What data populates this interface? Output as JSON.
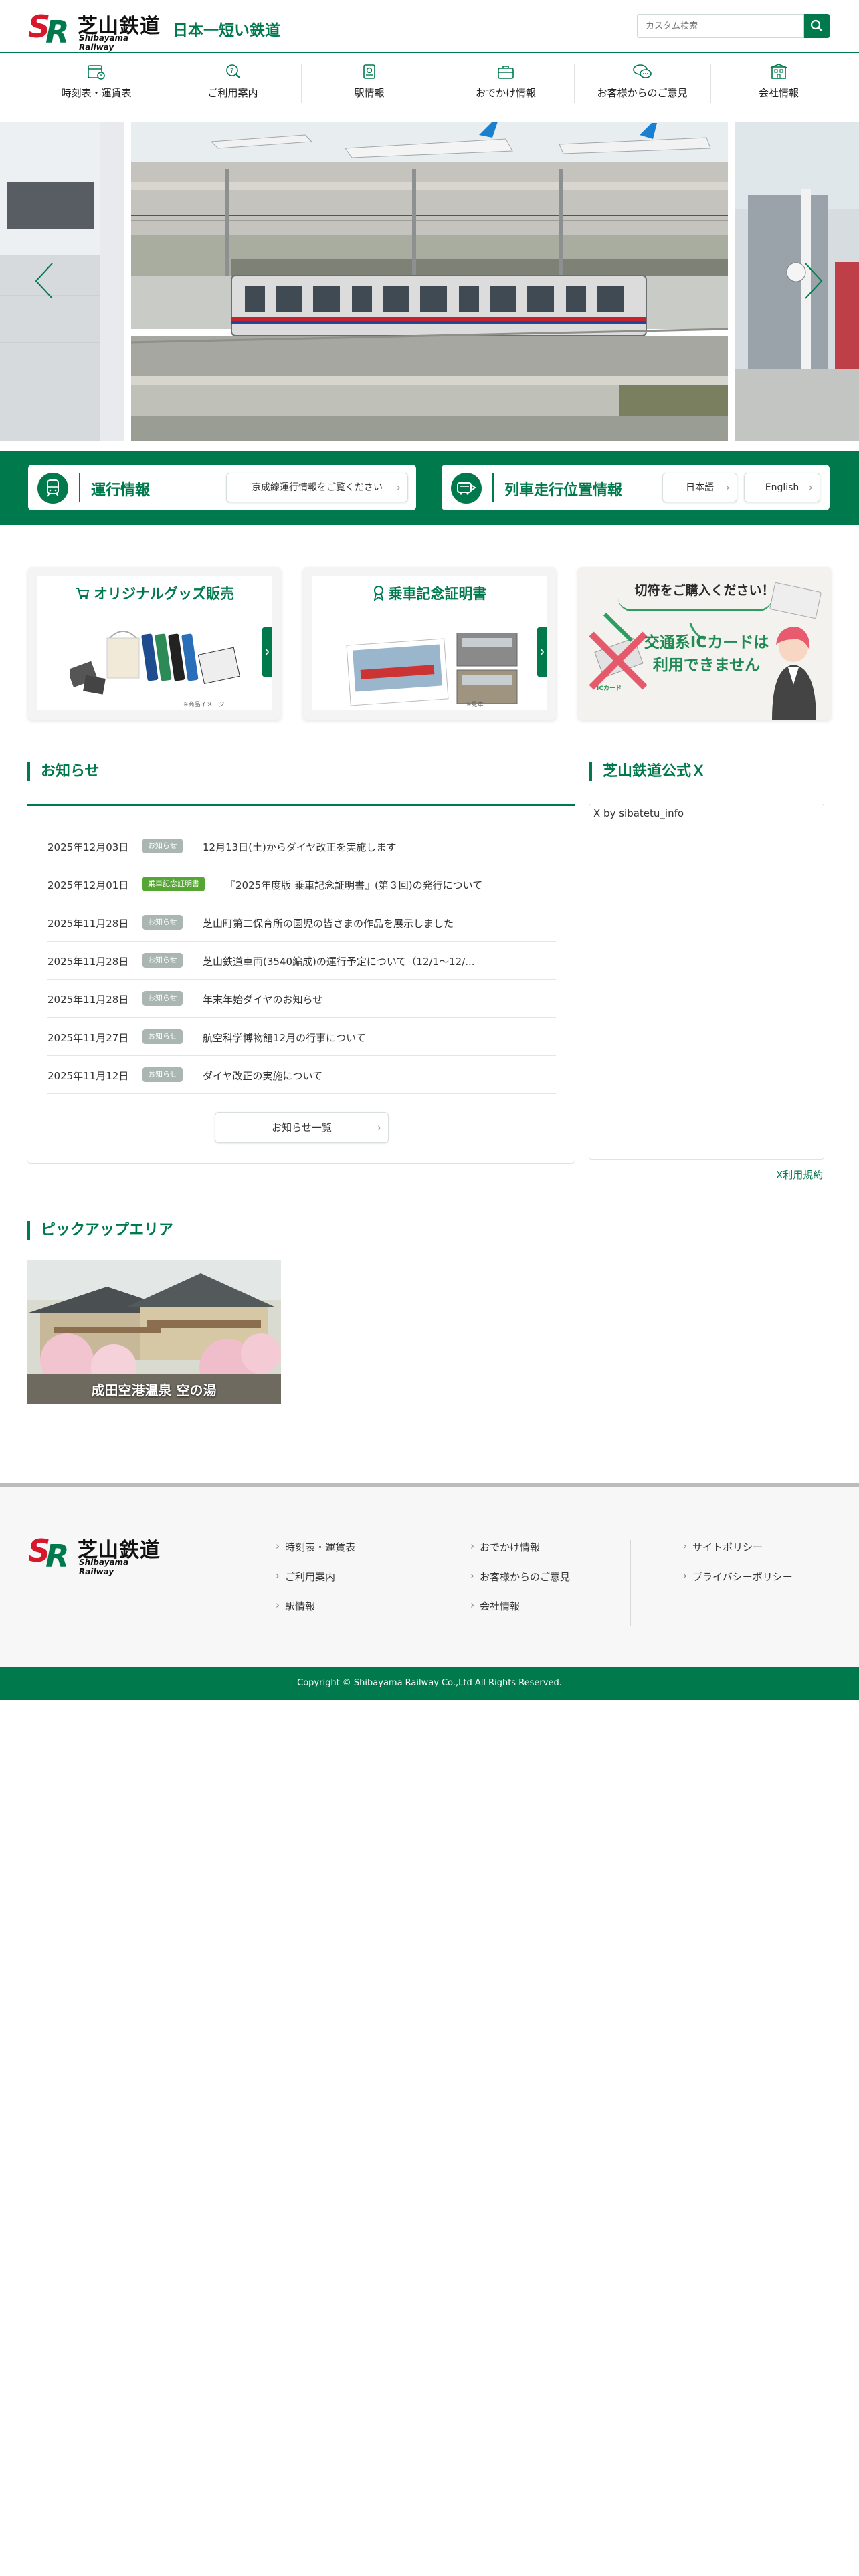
{
  "header": {
    "logo_text": "芝山鉄道",
    "logo_sub": "Shibayama Railway",
    "logo_mark": "SR",
    "tagline": "日本一短い鉄道",
    "search_placeholder": "カスタム検索"
  },
  "nav": [
    {
      "label": "時刻表・運賃表",
      "icon": "timetable-icon"
    },
    {
      "label": "ご利用案内",
      "icon": "guide-search-icon"
    },
    {
      "label": "駅情報",
      "icon": "station-icon"
    },
    {
      "label": "おでかけ情報",
      "icon": "outing-bag-icon"
    },
    {
      "label": "お客様からのご意見",
      "icon": "speech-bubble-icon"
    },
    {
      "label": "会社情報",
      "icon": "building-icon"
    }
  ],
  "status": {
    "operation_title": "運行情報",
    "operation_link": "京成線運行情報をご覧ください",
    "location_title": "列車走行位置情報",
    "lang_ja": "日本語",
    "lang_en": "English"
  },
  "banners": [
    {
      "title": "オリジナルグッズ販売",
      "note": "※商品イメージ"
    },
    {
      "title": "乗車記念証明書",
      "note": "※見本"
    },
    {
      "title": "切符をご購入ください！",
      "line1": "交通系ICカードは",
      "line2": "利用できません",
      "note": "ICカード"
    }
  ],
  "news": {
    "heading": "お知らせ",
    "items": [
      {
        "date": "2025年12月03日",
        "tag": "お知らせ",
        "tag_type": "gray",
        "title": "12月13日(土)からダイヤ改正を実施します"
      },
      {
        "date": "2025年12月01日",
        "tag": "乗車記念証明書",
        "tag_type": "green",
        "title": "『2025年度版 乗車記念証明書』(第３回)の発行について"
      },
      {
        "date": "2025年11月28日",
        "tag": "お知らせ",
        "tag_type": "gray",
        "title": "芝山町第二保育所の園児の皆さまの作品を展示しました"
      },
      {
        "date": "2025年11月28日",
        "tag": "お知らせ",
        "tag_type": "gray",
        "title": "芝山鉄道車両(3540編成)の運行予定について（12/1〜12/..."
      },
      {
        "date": "2025年11月28日",
        "tag": "お知らせ",
        "tag_type": "gray",
        "title": "年末年始ダイヤのお知らせ"
      },
      {
        "date": "2025年11月27日",
        "tag": "お知らせ",
        "tag_type": "gray",
        "title": "航空科学博物館12月の行事について"
      },
      {
        "date": "2025年11月12日",
        "tag": "お知らせ",
        "tag_type": "gray",
        "title": "ダイヤ改正の実施について"
      }
    ],
    "more_label": "お知らせ一覧"
  },
  "x_widget": {
    "heading": "芝山鉄道公式Ｘ",
    "by_text": "X by sibatetu_info",
    "terms_link": "X利用規約"
  },
  "pickup": {
    "heading": "ピックアップエリア",
    "items": [
      {
        "label": "成田空港温泉 空の湯"
      }
    ]
  },
  "footer": {
    "col1": [
      "時刻表・運賃表",
      "ご利用案内",
      "駅情報"
    ],
    "col2": [
      "おでかけ情報",
      "お客様からのご意見",
      "会社情報"
    ],
    "col3": [
      "サイトポリシー",
      "プライバシーポリシー"
    ],
    "copyright": "Copyright © Shibayama Railway Co.,Ltd All Rights Reserved."
  },
  "colors": {
    "brand_green": "#007a4d",
    "brand_red": "#d7182a",
    "tag_gray": "#aab6b2",
    "tag_green": "#55a632"
  }
}
